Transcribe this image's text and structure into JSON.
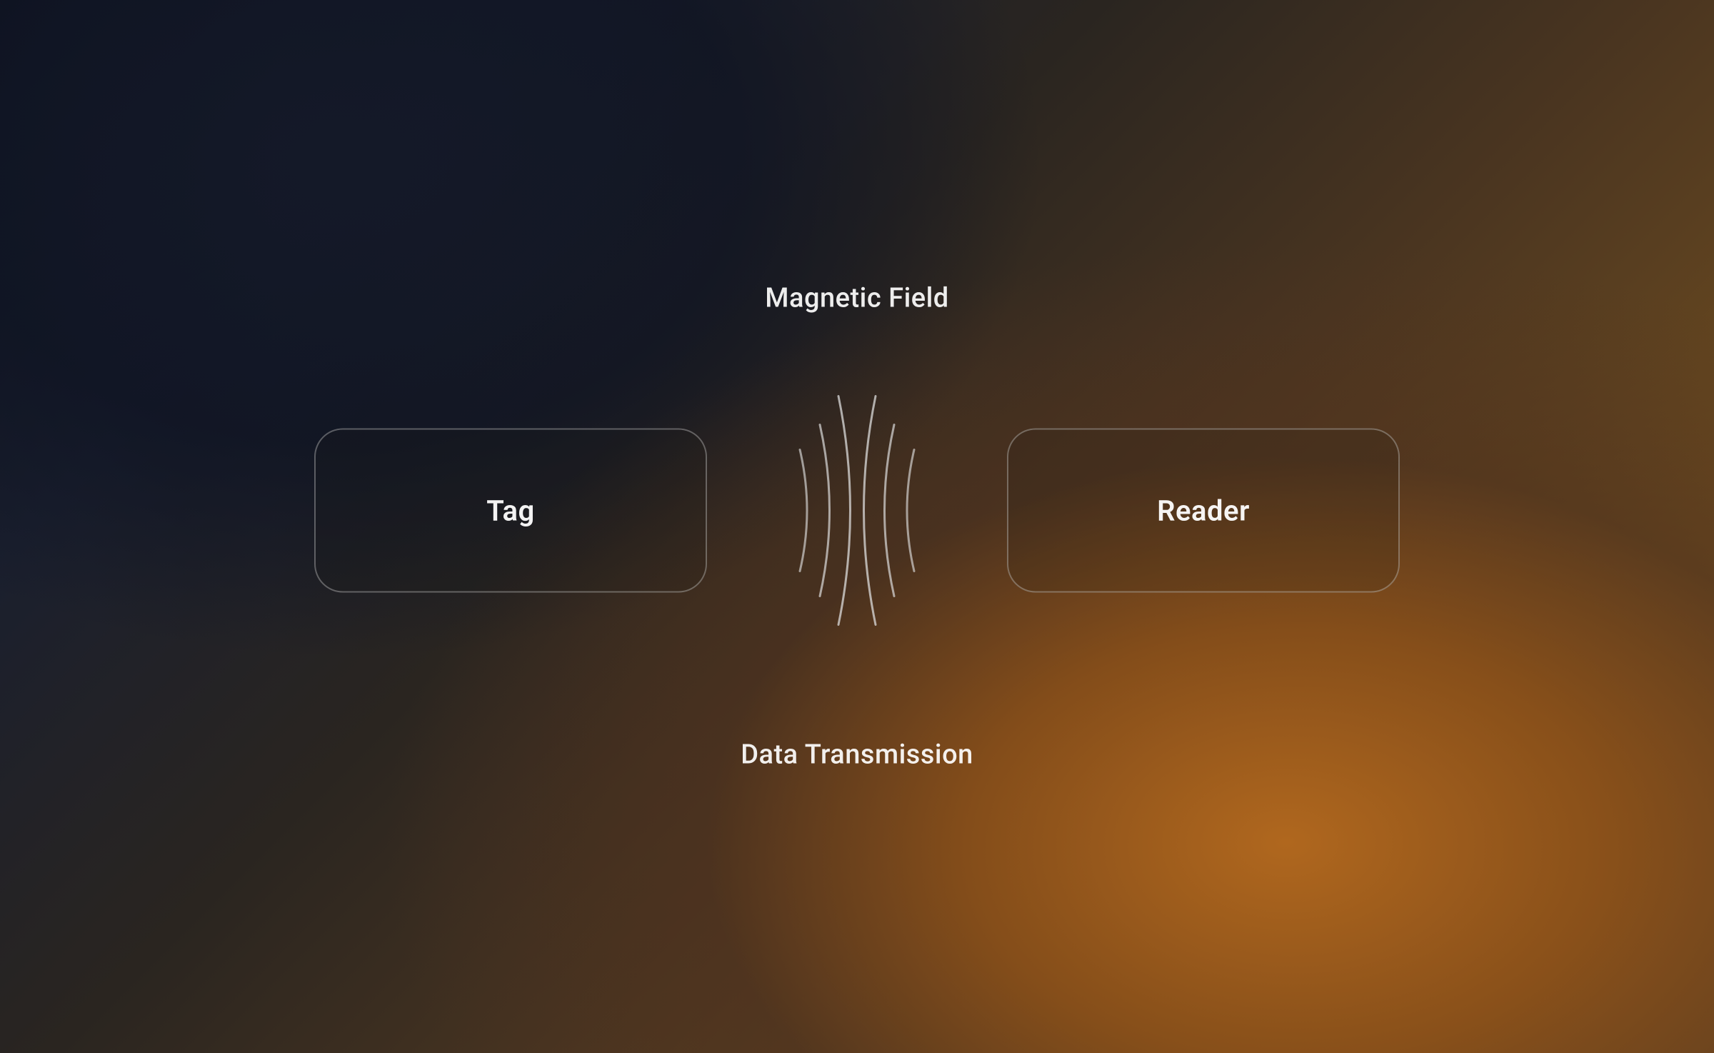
{
  "labels": {
    "top": "Magnetic Field",
    "bottom": "Data Transmission",
    "left_box": "Tag",
    "right_box": "Reader"
  }
}
